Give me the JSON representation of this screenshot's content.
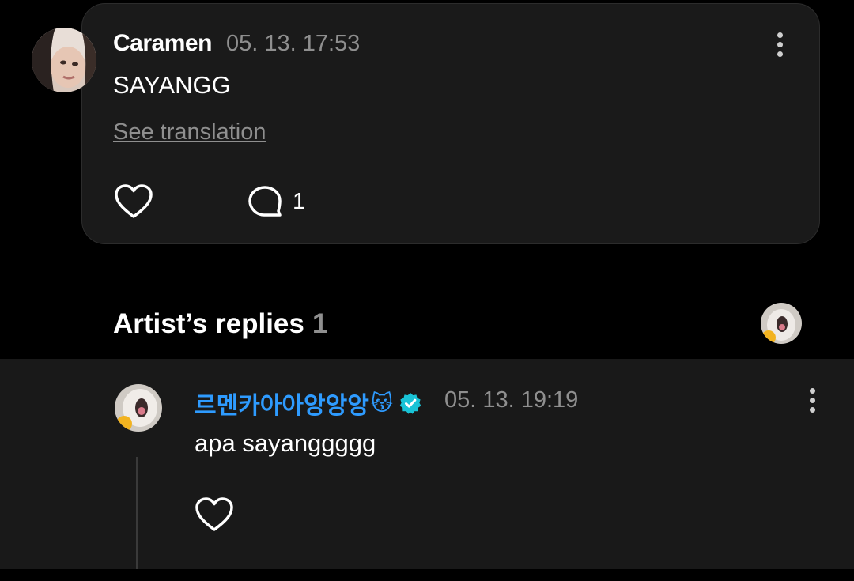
{
  "comment": {
    "author": "Caramen",
    "timestamp": "05. 13. 17:53",
    "text": "SAYANGG",
    "see_translation": "See translation",
    "reply_count": "1",
    "avatar_icon": "user-photo-avatar"
  },
  "artist_replies": {
    "title": "Artist’s replies",
    "count": "1",
    "avatar_icon": "artist-photo-avatar"
  },
  "reply": {
    "author": "르멘카아아앙앙앙",
    "author_emoji": "😽",
    "verified_icon": "verified-badge-icon",
    "timestamp": "05. 13. 19:19",
    "text": "apa sayanggggg"
  },
  "colors": {
    "background": "#000000",
    "card": "#1a1a1a",
    "artist_name": "#2e9bff",
    "muted": "#8f8f8f",
    "verified": "#19c3d6"
  }
}
